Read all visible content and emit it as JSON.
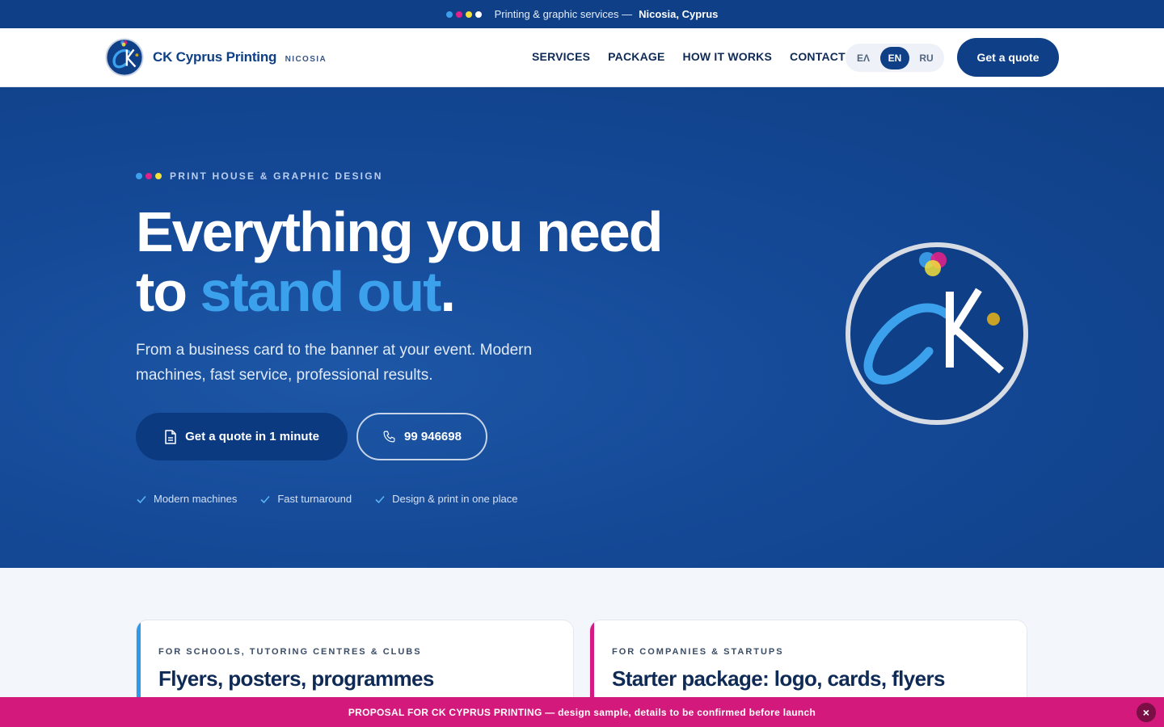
{
  "topbar": {
    "text": "Printing & graphic services —",
    "location": "Nicosia, Cyprus",
    "dot_colors": [
      "#3ca1ec",
      "#e0218a",
      "#f2e13a",
      "#ffffff"
    ]
  },
  "header": {
    "brand_name": "CK Cyprus Printing",
    "brand_city": "NICOSIA",
    "nav": [
      "SERVICES",
      "PACKAGE",
      "HOW IT WORKS",
      "CONTACT"
    ],
    "languages": [
      "ΕΛ",
      "EN",
      "RU"
    ],
    "active_language": "EN",
    "quote_label": "Get a quote"
  },
  "hero": {
    "eyebrow": "PRINT HOUSE & GRAPHIC DESIGN",
    "title_line1": "Everything you need",
    "title_line2_prefix": "to ",
    "title_line2_accent": "stand out",
    "title_line2_suffix": ".",
    "lead": "From a business card to the banner at your event. Modern machines, fast service, professional results.",
    "cta_primary": "Get a quote in 1 minute",
    "cta_phone": "99 946698",
    "ticks": [
      "Modern machines",
      "Fast turnaround",
      "Design & print in one place"
    ]
  },
  "cards": [
    {
      "tag": "FOR SCHOOLS, TUTORING CENTRES & CLUBS",
      "title": "Flyers, posters, programmes"
    },
    {
      "tag": "FOR COMPANIES & STARTUPS",
      "title": "Starter package: logo, cards, flyers"
    }
  ],
  "banner": {
    "text": "PROPOSAL FOR CK CYPRUS PRINTING — design sample, details to be confirmed before launch",
    "close": "×"
  },
  "colors": {
    "navy": "#0f3f86",
    "accent_blue": "#3ca1ec",
    "magenta": "#d4197c",
    "yellow": "#f2e13a"
  }
}
